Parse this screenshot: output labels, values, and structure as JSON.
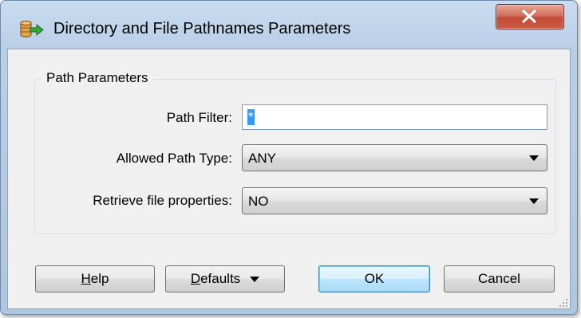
{
  "window": {
    "title": "Directory and File Pathnames Parameters",
    "icon": "database-export-icon",
    "close_glyph": "X"
  },
  "group": {
    "title": "Path Parameters"
  },
  "fields": {
    "path_filter": {
      "label": "Path Filter:",
      "value": "*"
    },
    "allowed_path_type": {
      "label": "Allowed Path Type:",
      "value": "ANY"
    },
    "retrieve_file_properties": {
      "label": "Retrieve file properties:",
      "value": "NO"
    }
  },
  "buttons": {
    "help_mnemonic": "H",
    "help_rest": "elp",
    "defaults_mnemonic": "D",
    "defaults_rest": "efaults",
    "ok": "OK",
    "cancel": "Cancel"
  },
  "colors": {
    "selection": "#3399ff",
    "close_button": "#c84a35",
    "default_button_border": "#3c7fb1"
  }
}
